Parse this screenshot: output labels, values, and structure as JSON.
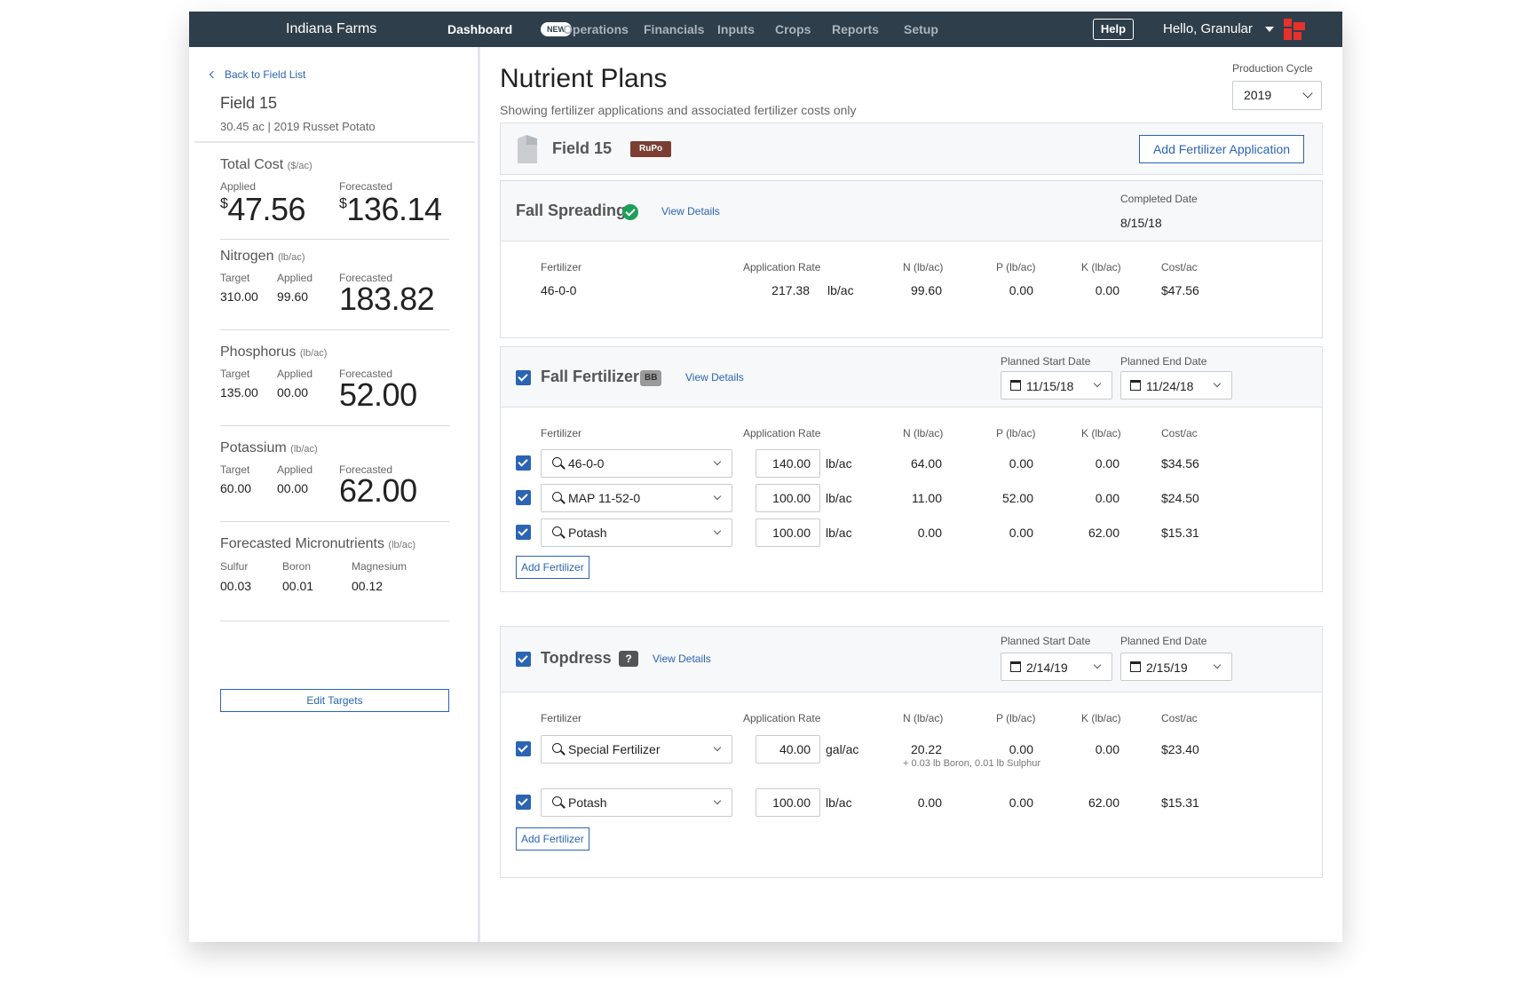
{
  "nav": {
    "farm": "Indiana Farms",
    "items": [
      "Dashboard",
      "Operations",
      "Financials",
      "Inputs",
      "Crops",
      "Reports",
      "Setup"
    ],
    "new_badge": "NEW",
    "help": "Help",
    "user": "Hello, Granular",
    "logo_color": "#e8312a",
    "bg_color": "#2e3e4b"
  },
  "sidebar": {
    "back": "Back to Field List",
    "field_name": "Field 15",
    "field_sub": "30.45 ac | 2019 Russet Potato",
    "total_cost": {
      "title": "Total Cost",
      "unit": "($/ac)",
      "applied_label": "Applied",
      "applied_currency": "$",
      "applied": "47.56",
      "forecasted_label": "Forecasted",
      "forecasted_currency": "$",
      "forecasted": "136.14"
    },
    "nitrogen": {
      "title": "Nitrogen",
      "unit": "(lb/ac)",
      "target_label": "Target",
      "target": "310.00",
      "applied_label": "Applied",
      "applied": "99.60",
      "forecasted_label": "Forecasted",
      "forecasted": "183.82"
    },
    "phosphorus": {
      "title": "Phosphorus",
      "unit": "(lb/ac)",
      "target_label": "Target",
      "target": "135.00",
      "applied_label": "Applied",
      "applied": "00.00",
      "forecasted_label": "Forecasted",
      "forecasted": "52.00"
    },
    "potassium": {
      "title": "Potassium",
      "unit": "(lb/ac)",
      "target_label": "Target",
      "target": "60.00",
      "applied_label": "Applied",
      "applied": "00.00",
      "forecasted_label": "Forecasted",
      "forecasted": "62.00"
    },
    "micro": {
      "title": "Forecasted Micronutrients",
      "unit": "(lb/ac)",
      "sulfur_label": "Sulfur",
      "sulfur": "00.03",
      "boron_label": "Boron",
      "boron": "00.01",
      "magnesium_label": "Magnesium",
      "magnesium": "00.12"
    },
    "edit_targets": "Edit Targets"
  },
  "main": {
    "title": "Nutrient Plans",
    "subtitle": "Showing fertilizer applications and associated fertilizer costs only",
    "production_cycle_label": "Production Cycle",
    "production_cycle": "2019",
    "field_card": {
      "name": "Field 15",
      "badge": "RuPo",
      "badge_color": "#7a3f32",
      "add_button": "Add Fertilizer Application"
    },
    "columns": {
      "fertilizer": "Fertilizer",
      "rate": "Application Rate",
      "n": "N (lb/ac)",
      "p": "P (lb/ac)",
      "k": "K (lb/ac)",
      "cost": "Cost/ac"
    },
    "fall_spreading": {
      "title": "Fall Spreading",
      "view_details": "View Details",
      "completed_label": "Completed Date",
      "completed_date": "8/15/18",
      "rows": [
        {
          "fertilizer": "46-0-0",
          "rate": "217.38",
          "unit": "lb/ac",
          "n": "99.60",
          "p": "0.00",
          "k": "0.00",
          "cost": "$47.56"
        }
      ]
    },
    "fall_fertilizer": {
      "title": "Fall Fertilizer",
      "badge": "BB",
      "view_details": "View Details",
      "start_label": "Planned Start Date",
      "start_date": "11/15/18",
      "end_label": "Planned End Date",
      "end_date": "11/24/18",
      "rows": [
        {
          "fertilizer": "46-0-0",
          "rate": "140.00",
          "unit": "lb/ac",
          "n": "64.00",
          "p": "0.00",
          "k": "0.00",
          "cost": "$34.56"
        },
        {
          "fertilizer": "MAP 11-52-0",
          "rate": "100.00",
          "unit": "lb/ac",
          "n": "11.00",
          "p": "52.00",
          "k": "0.00",
          "cost": "$24.50"
        },
        {
          "fertilizer": "Potash",
          "rate": "100.00",
          "unit": "lb/ac",
          "n": "0.00",
          "p": "0.00",
          "k": "62.00",
          "cost": "$15.31"
        }
      ],
      "add_fertilizer": "Add Fertilizer"
    },
    "topdress": {
      "title": "Topdress",
      "badge": "?",
      "view_details": "View Details",
      "start_label": "Planned Start Date",
      "start_date": "2/14/19",
      "end_label": "Planned End Date",
      "end_date": "2/15/19",
      "rows": [
        {
          "fertilizer": "Special Fertilizer",
          "rate": "40.00",
          "unit": "gal/ac",
          "n": "20.22",
          "p": "0.00",
          "k": "0.00",
          "cost": "$23.40",
          "note": "+ 0.03 lb Boron, 0.01 lb Sulphur"
        },
        {
          "fertilizer": "Potash",
          "rate": "100.00",
          "unit": "lb/ac",
          "n": "0.00",
          "p": "0.00",
          "k": "62.00",
          "cost": "$15.31"
        }
      ],
      "add_fertilizer": "Add Fertilizer"
    }
  }
}
